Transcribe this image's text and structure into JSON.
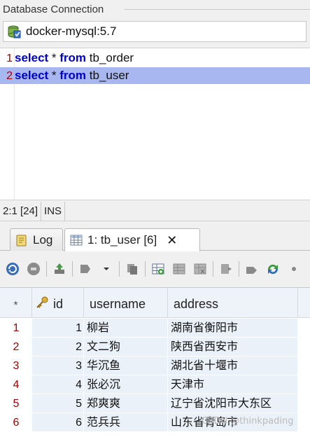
{
  "section": {
    "title": "Database Connection"
  },
  "connection": {
    "name": "docker-mysql:5.7"
  },
  "editor": {
    "lines": [
      {
        "number": "1",
        "keyword1": "select",
        "star": " * ",
        "keyword2": "from",
        "table": " tb_order",
        "selected": false
      },
      {
        "number": "2",
        "keyword1": "select",
        "star": " * ",
        "keyword2": "from",
        "table": " tb_user",
        "selected": true
      }
    ]
  },
  "status": {
    "position": "2:1 [24]",
    "mode": "INS"
  },
  "tabs": [
    {
      "label": "Log",
      "icon": "log-icon",
      "active": false
    },
    {
      "label": "1: tb_user [6]",
      "icon": "grid-icon",
      "active": true,
      "close": "✕"
    }
  ],
  "grid": {
    "corner": "*",
    "columns": [
      "id",
      "username",
      "address"
    ],
    "rows": [
      {
        "rownum": "1",
        "id": "1",
        "username": "柳岩",
        "address": "湖南省衡阳市"
      },
      {
        "rownum": "2",
        "id": "2",
        "username": "文二狗",
        "address": "陕西省西安市"
      },
      {
        "rownum": "3",
        "id": "3",
        "username": "华沉鱼",
        "address": "湖北省十堰市"
      },
      {
        "rownum": "4",
        "id": "4",
        "username": "张必沉",
        "address": "天津市"
      },
      {
        "rownum": "5",
        "id": "5",
        "username": "郑爽爽",
        "address": "辽宁省沈阳市大东区"
      },
      {
        "rownum": "6",
        "id": "6",
        "username": "范兵兵",
        "address": "山东省青岛市"
      }
    ]
  },
  "watermark": "CSDN @thinkpading",
  "colors": {
    "selection": "#a9b7f0",
    "keyword": "#0000cc",
    "rowNumber": "#a00000",
    "cellBg": "#eaf1f9"
  }
}
